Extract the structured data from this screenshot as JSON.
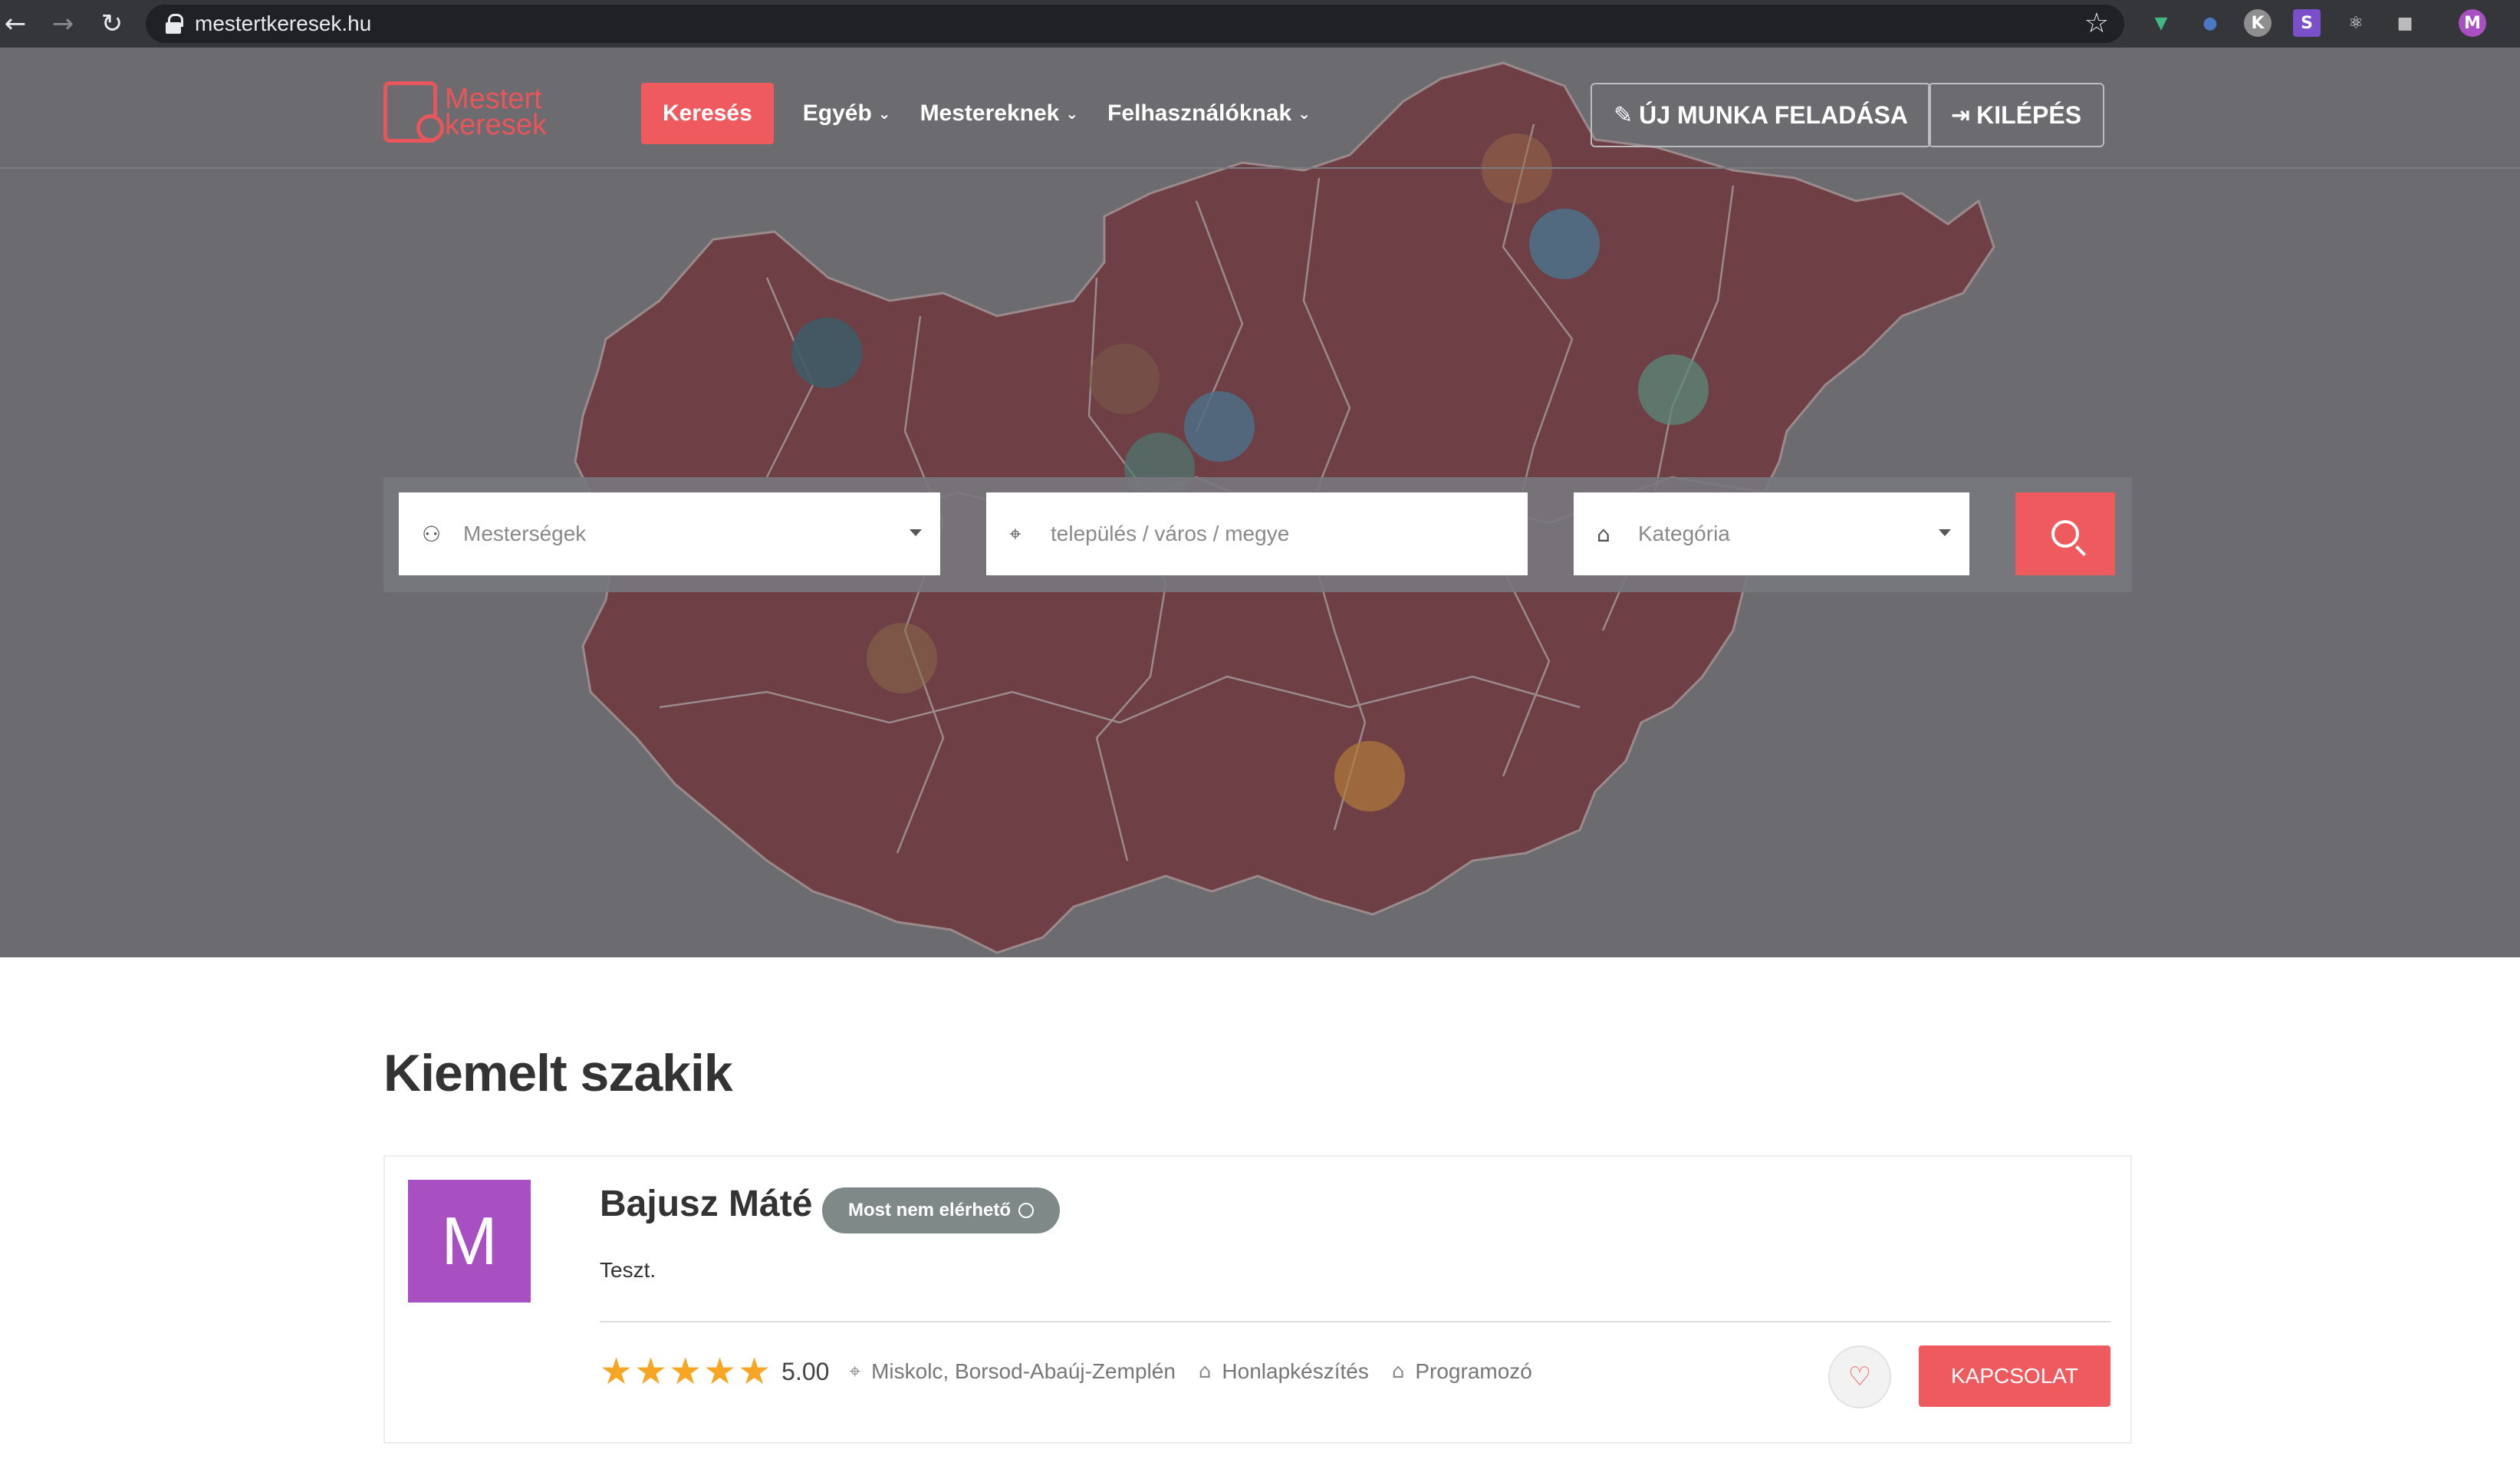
{
  "browser": {
    "url": "mestertkeresek.hu",
    "profile_initial": "M",
    "extensions": [
      {
        "name": "vue-devtools-icon",
        "letter": "▼",
        "color": "#41b883"
      },
      {
        "name": "extension-blue-icon",
        "letter": "●",
        "color": "#4a78c2"
      },
      {
        "name": "extension-k-icon",
        "letter": "K",
        "color": "#8e8e8e"
      },
      {
        "name": "extension-s-icon",
        "letter": "S",
        "color": "#7b4fc9"
      },
      {
        "name": "react-devtools-icon",
        "letter": "⚛",
        "color": "#35363a"
      },
      {
        "name": "extension-cube-icon",
        "letter": "■",
        "color": "#35363a"
      }
    ]
  },
  "header": {
    "logo_line1": "Mestert",
    "logo_line2": "keresek",
    "nav": {
      "active": "Keresés",
      "items": [
        "Egyéb",
        "Mestereknek",
        "Felhasználóknak"
      ]
    },
    "new_job_button": "ÚJ MUNKA FELADÁSA",
    "logout_button": "KILÉPÉS"
  },
  "search": {
    "profession_placeholder": "Mesterségek",
    "location_placeholder": "település / város / megye",
    "category_placeholder": "Kategória"
  },
  "featured": {
    "title": "Kiemelt szakik",
    "card": {
      "avatar_letter": "M",
      "name": "Bajusz Máté",
      "status": "Most nem elérhető",
      "description": "Teszt.",
      "stars": 5,
      "rating": "5.00",
      "location": "Miskolc, Borsod-Abaúj-Zemplén",
      "tags": [
        "Honlapkészítés",
        "Programozó"
      ],
      "contact_button": "KAPCSOLAT"
    }
  },
  "colors": {
    "accent": "#ef5a5f",
    "avatar": "#a84fc1",
    "map": "#6e3f44",
    "hero_bg": "#6b6b70",
    "star": "#f6a623"
  }
}
